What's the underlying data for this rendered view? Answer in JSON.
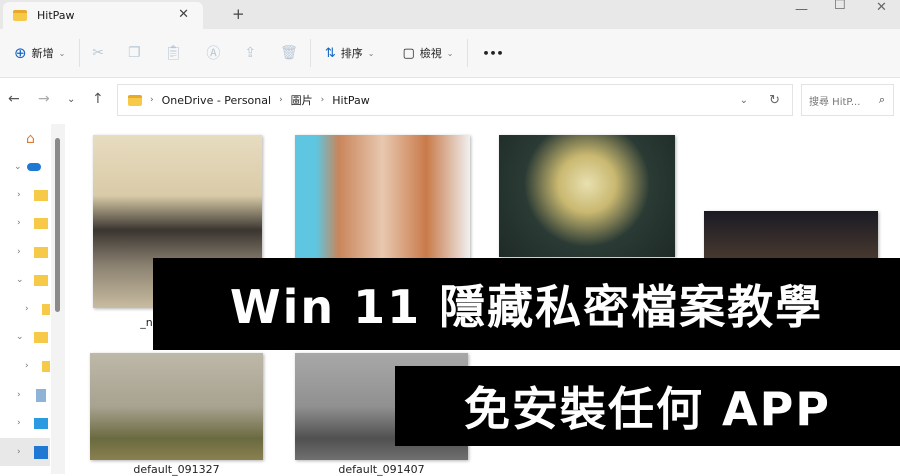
{
  "tab": {
    "title": "HitPaw",
    "close": "✕",
    "new_tab": "+"
  },
  "window": {
    "minimize": "—",
    "maximize": "☐",
    "close": "✕"
  },
  "toolbar": {
    "new_label": "新增",
    "sort_label": "排序",
    "view_label": "檢視",
    "more": "•••"
  },
  "breadcrumb": [
    "OneDrive - Personal",
    "圖片",
    "HitPaw"
  ],
  "search": {
    "placeholder": "搜尋 HitP..."
  },
  "files": [
    {
      "name": "_news.kcy_pa"
    },
    {
      "name": ""
    },
    {
      "name": ""
    },
    {
      "name": ""
    },
    {
      "name": "default_091327"
    },
    {
      "name": "default_091407"
    }
  ],
  "banner": {
    "line1": "Win 11 隱藏私密檔案教學",
    "line2": "免安裝任何 APP"
  }
}
